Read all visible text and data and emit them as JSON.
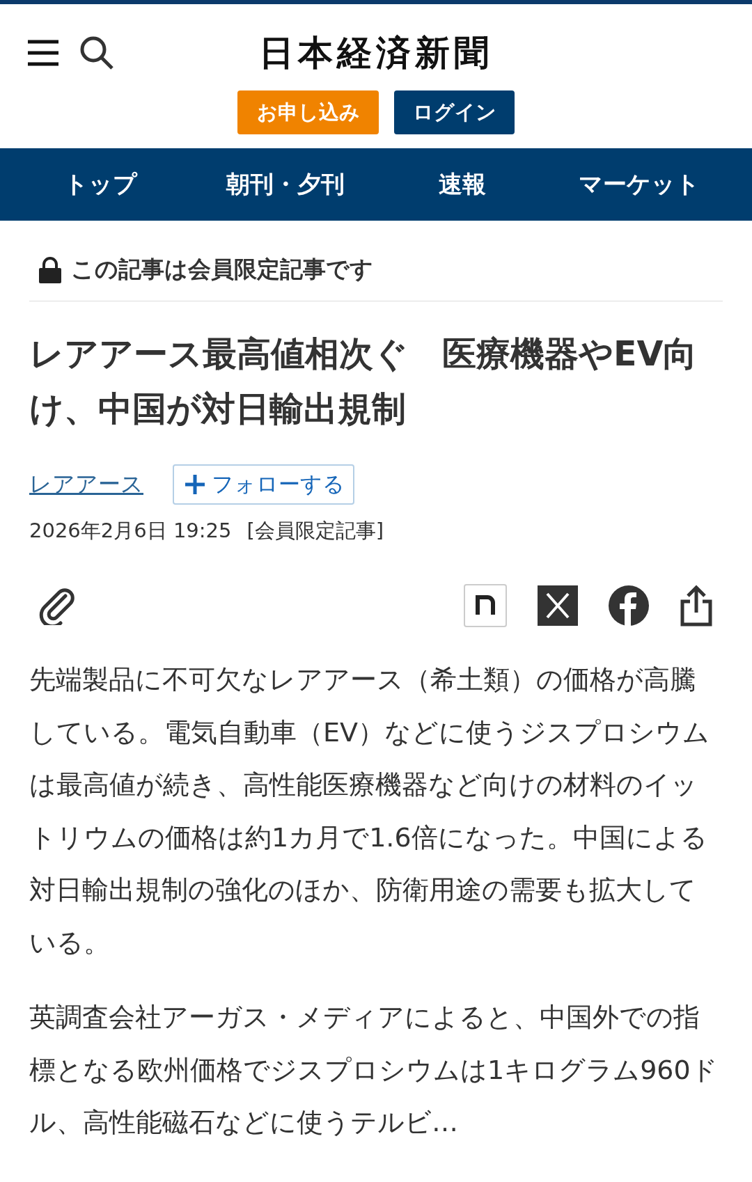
{
  "header": {
    "logo": "日本経済新聞",
    "buttons": [
      {
        "label": "お申し込み",
        "kind": "primary"
      },
      {
        "label": "ログイン",
        "kind": "secondary"
      }
    ]
  },
  "nav": [
    {
      "label": "トップ"
    },
    {
      "label": "朝刊・夕刊"
    },
    {
      "label": "速報"
    },
    {
      "label": "マーケット"
    }
  ],
  "notice": "この記事は会員限定記事です",
  "headline": "レアアース最高値相次ぐ　医療機器やEV向け、中国が対日輸出規制",
  "topic": {
    "label": "レアアース",
    "follow": "フォローする"
  },
  "meta": {
    "date": "2026年2月6日 19:25",
    "badge": "[会員限定記事]"
  },
  "body": [
    "先端製品に不可欠なレアアース（希土類）の価格が高騰している。電気自動車（EV）などに使うジスプロシウムは最高値が続き、高性能医療機器など向けの材料のイットリウムの価格は約1カ月で1.6倍になった。中国による対日輸出規制の強化のほか、防衛用途の需要も拡大している。",
    "英調査会社アーガス・メディアによると、中国外での指標となる欧州価格でジスプロシウムは1キログラム960ドル、高性能磁石などに使うテルビ…"
  ]
}
